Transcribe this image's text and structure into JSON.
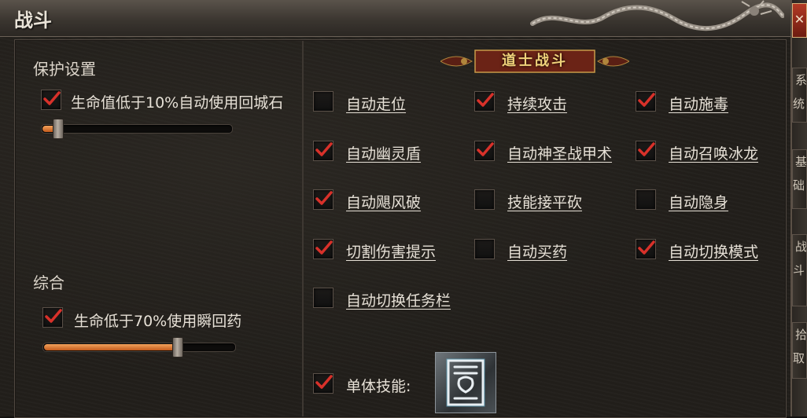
{
  "window": {
    "title": "战斗"
  },
  "protection": {
    "heading": "保护设置",
    "option": {
      "label": "生命值低于10%自动使用回城石",
      "checked": true
    },
    "slider_level": 0.08
  },
  "general": {
    "heading": "综合",
    "option": {
      "label": "生命低于70%使用瞬回药",
      "checked": true
    },
    "slider_level": 0.7
  },
  "taoist": {
    "banner": "道士战斗",
    "options": [
      {
        "label": "自动走位",
        "checked": false
      },
      {
        "label": "持续攻击",
        "checked": true
      },
      {
        "label": "自动施毒",
        "checked": true
      },
      {
        "label": "自动幽灵盾",
        "checked": true
      },
      {
        "label": "自动神圣战甲术",
        "checked": true
      },
      {
        "label": "自动召唤冰龙",
        "checked": true
      },
      {
        "label": "自动飓风破",
        "checked": true
      },
      {
        "label": "技能接平砍",
        "checked": false
      },
      {
        "label": "自动隐身",
        "checked": false
      },
      {
        "label": "切割伤害提示",
        "checked": true
      },
      {
        "label": "自动买药",
        "checked": false
      },
      {
        "label": "自动切换模式",
        "checked": true
      },
      {
        "label": "自动切换任务栏",
        "checked": false
      }
    ],
    "single_skill": {
      "label": "单体技能:",
      "checked": true,
      "icon": "skill-rune-icon"
    }
  },
  "side_tabs": [
    "系统",
    "基础",
    "战斗",
    "拾取"
  ],
  "colors": {
    "check": "#d8312a",
    "accent_fill": "#e0803c",
    "banner_text": "#f0d27a"
  }
}
